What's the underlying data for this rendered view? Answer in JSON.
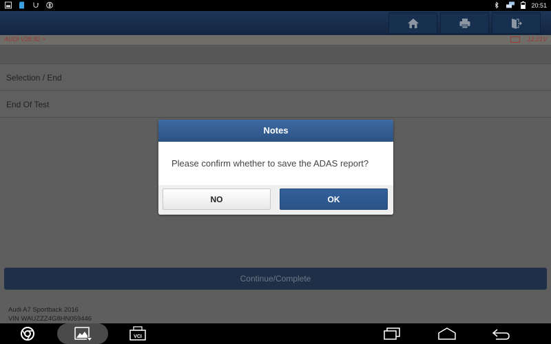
{
  "status_bar": {
    "left_icons": [
      "gallery-icon",
      "sd-card-icon",
      "usb-debug-icon",
      "vpn-circle-icon"
    ],
    "right_icons": [
      "bluetooth-icon",
      "network-icon",
      "battery-icon"
    ],
    "time": "20:51"
  },
  "header": {
    "buttons": [
      {
        "name": "home",
        "icon": "home-icon"
      },
      {
        "name": "print",
        "icon": "printer-icon"
      },
      {
        "name": "exit",
        "icon": "exit-icon"
      }
    ]
  },
  "breadcrumb": {
    "path": "AUDI V28.82 >",
    "voltage": "12.21V",
    "voltage_icon": "car-battery-icon",
    "accent_color": "#9a3a34"
  },
  "list": {
    "items": [
      {
        "label": "Selection / End"
      },
      {
        "label": "End Of Test"
      }
    ]
  },
  "continue_button": {
    "label": "Continue/Complete"
  },
  "vehicle": {
    "model": "Audi A7 Sportback 2016",
    "vin": "VIN WAUZZZ4G8HN059446"
  },
  "dialog": {
    "title": "Notes",
    "message": "Please confirm whether to save the ADAS report?",
    "no_label": "NO",
    "ok_label": "OK",
    "accent_color": "#2c5283"
  },
  "nav_bar": {
    "left_icons": [
      "chrome-icon",
      "screenshot-gallery-icon",
      "vci-icon"
    ],
    "right_icons": [
      "recent-apps-icon",
      "home-nav-icon",
      "back-icon"
    ],
    "vci_label": "VCI"
  }
}
